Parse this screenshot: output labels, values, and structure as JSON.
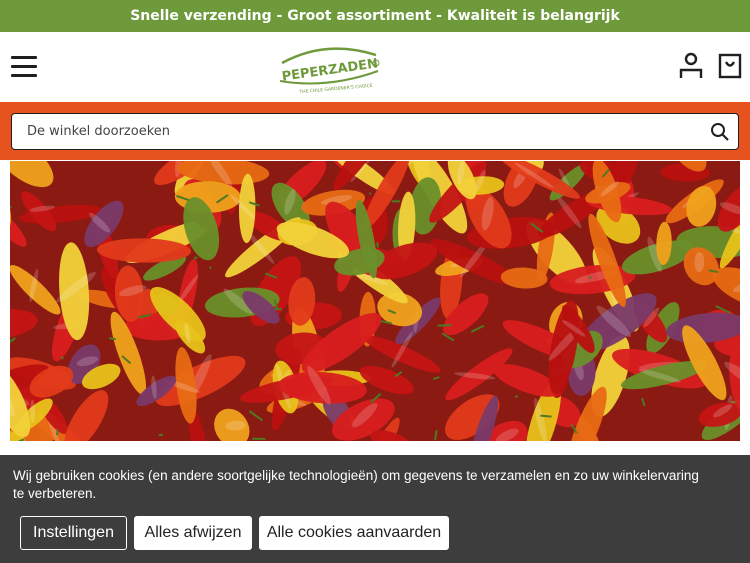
{
  "promo": {
    "text": "Snelle verzending - Groot assortiment - Kwaliteit is belangrijk"
  },
  "header": {
    "logo_text": "PEPERZADEN",
    "logo_tagline": "THE CHILE GARDENER'S CHOICE"
  },
  "search": {
    "placeholder": "De winkel doorzoeken"
  },
  "cookie": {
    "text": "Wij gebruiken cookies (en andere soortgelijke technologieën) om gegevens te verzamelen en zo uw winkelervaring te verbeteren.",
    "settings_label": "Instellingen",
    "reject_label": "Alles afwijzen",
    "accept_label": "Alle cookies aanvaarden"
  },
  "colors": {
    "promo_bg": "#6f9a3c",
    "brand_green": "#6f9a3c",
    "search_band": "#e6531f",
    "cookie_bg": "#3d3d3d"
  },
  "icons": {
    "menu": "hamburger-menu-icon",
    "account": "user-account-icon",
    "cart": "shopping-bag-icon",
    "search": "search-icon"
  }
}
